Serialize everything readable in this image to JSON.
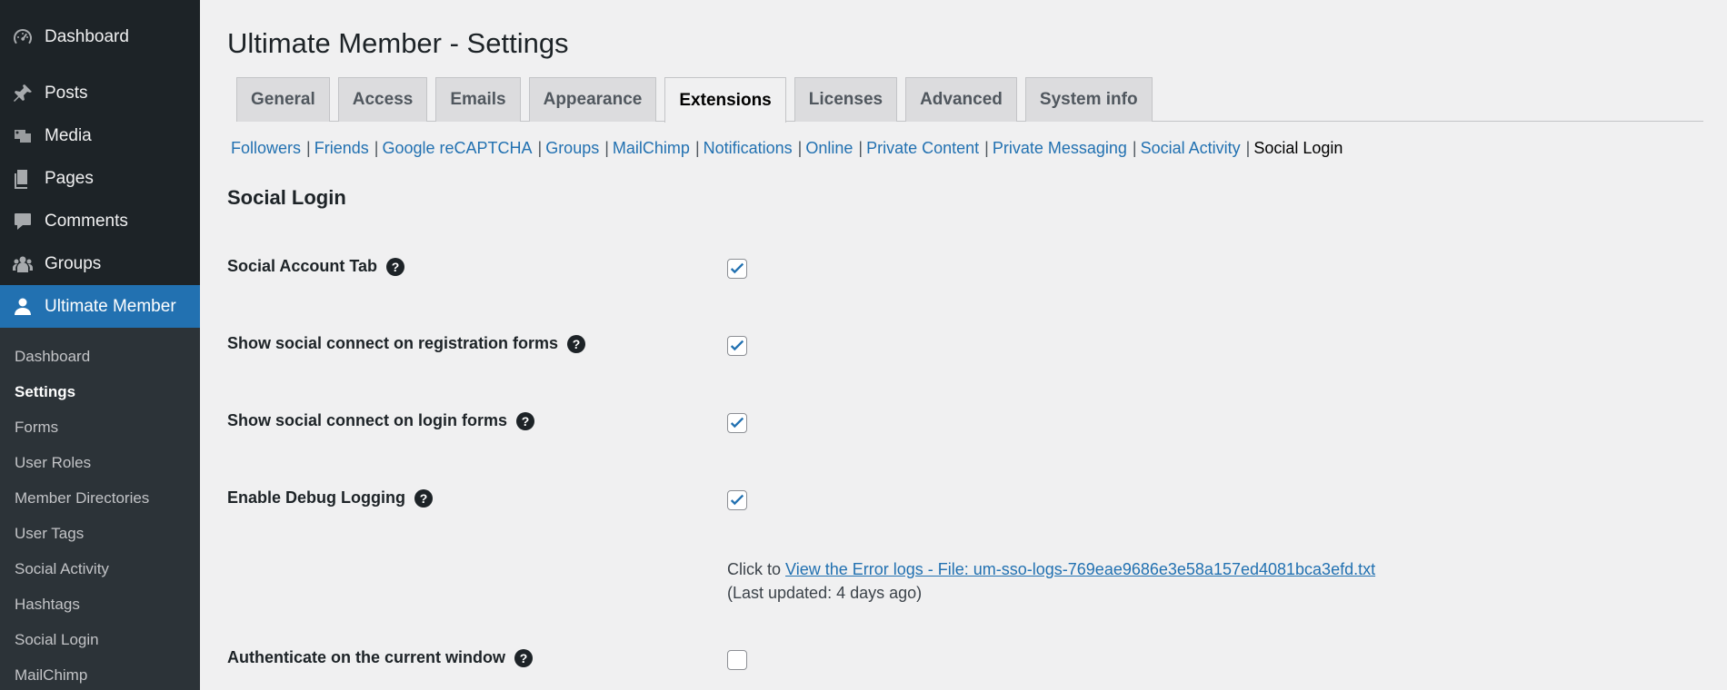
{
  "sidebar": {
    "menu": [
      {
        "label": "Dashboard",
        "icon": "dashboard-icon"
      },
      {
        "label": "Posts",
        "icon": "pin-icon"
      },
      {
        "label": "Media",
        "icon": "media-icon"
      },
      {
        "label": "Pages",
        "icon": "pages-icon"
      },
      {
        "label": "Comments",
        "icon": "comment-icon"
      },
      {
        "label": "Groups",
        "icon": "groups-icon"
      },
      {
        "label": "Ultimate Member",
        "icon": "user-icon"
      }
    ],
    "submenu": [
      "Dashboard",
      "Settings",
      "Forms",
      "User Roles",
      "Member Directories",
      "User Tags",
      "Social Activity",
      "Hashtags",
      "Social Login",
      "MailChimp"
    ]
  },
  "page": {
    "title": "Ultimate Member - Settings"
  },
  "tabs": [
    "General",
    "Access",
    "Emails",
    "Appearance",
    "Extensions",
    "Licenses",
    "Advanced",
    "System info"
  ],
  "active_tab": "Extensions",
  "subsub": [
    "Followers",
    "Friends",
    "Google reCAPTCHA",
    "Groups",
    "MailChimp",
    "Notifications",
    "Online",
    "Private Content",
    "Private Messaging",
    "Social Activity",
    "Social Login"
  ],
  "section": {
    "title": "Social Login"
  },
  "fields": [
    {
      "label": "Social Account Tab",
      "checked": true
    },
    {
      "label": "Show social connect on registration forms",
      "checked": true
    },
    {
      "label": "Show social connect on login forms",
      "checked": true
    },
    {
      "label": "Enable Debug Logging",
      "checked": true
    },
    {
      "label": "Authenticate on the current window",
      "checked": false
    }
  ],
  "debug_log": {
    "prefix": "Click to ",
    "link": "View the Error logs - File: um-sso-logs-769eae9686e3e58a157ed4081bca3efd.txt",
    "updated": "(Last updated: 4 days ago)"
  },
  "colors": {
    "accent": "#2271b1",
    "sidebar_bg": "#1d2327",
    "submenu_bg": "#2c3338",
    "page_bg": "#f0f0f1"
  }
}
